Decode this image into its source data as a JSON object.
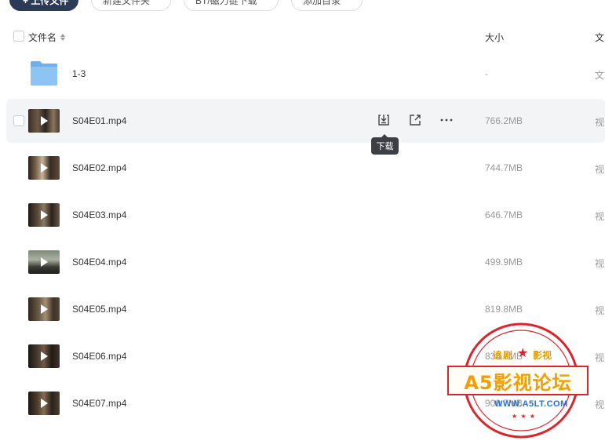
{
  "toolbar": {
    "upload_label": "+ 上传文件",
    "new_folder_label": "新建文件夹",
    "bt_label": "BT/磁力链下载",
    "add_share_label": "添加目录"
  },
  "header": {
    "name_label": "文件名",
    "size_label": "大小",
    "type_label": "文"
  },
  "folder_row": {
    "name": "1-3",
    "size": "-",
    "type": "文"
  },
  "files": [
    {
      "name": "S04E01.mp4",
      "size": "766.2MB",
      "type": "视"
    },
    {
      "name": "S04E02.mp4",
      "size": "744.7MB",
      "type": "视"
    },
    {
      "name": "S04E03.mp4",
      "size": "646.7MB",
      "type": "视"
    },
    {
      "name": "S04E04.mp4",
      "size": "499.9MB",
      "type": "视"
    },
    {
      "name": "S04E05.mp4",
      "size": "819.8MB",
      "type": "视"
    },
    {
      "name": "S04E06.mp4",
      "size": "838.7MB",
      "type": "视"
    },
    {
      "name": "S04E07.mp4",
      "size": "900.7MB",
      "type": "视"
    }
  ],
  "actions": {
    "download_icon": "download-icon",
    "share_icon": "external-link-icon",
    "more_icon": "more-icon",
    "tooltip": "下载"
  },
  "watermark": {
    "brand_left": "追剧",
    "brand_right": "影视",
    "title": "A5影视论坛",
    "url": "WWW.A5LT.COM"
  },
  "colors": {
    "primary_button": "#2b3a55",
    "row_hover": "#f3f4f6",
    "folder": "#7ab8f0",
    "stamp_red": "#d8262d",
    "stamp_gold": "#f0a000"
  }
}
